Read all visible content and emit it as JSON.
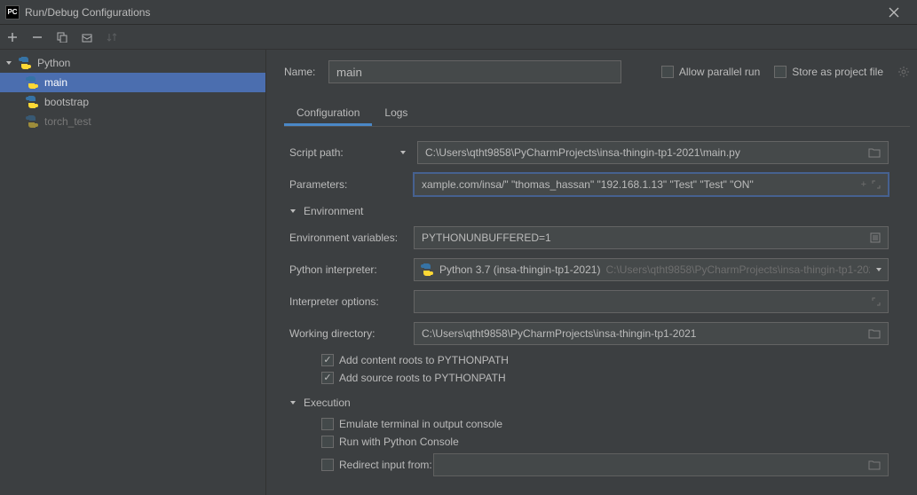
{
  "window": {
    "title": "Run/Debug Configurations"
  },
  "tree": {
    "root_label": "Python",
    "items": [
      {
        "label": "main",
        "selected": true,
        "muted": false
      },
      {
        "label": "bootstrap",
        "selected": false,
        "muted": false
      },
      {
        "label": "torch_test",
        "selected": false,
        "muted": true
      }
    ]
  },
  "header": {
    "name_label": "Name:",
    "name_value": "main",
    "allow_parallel": "Allow parallel run",
    "store_as_project": "Store as project file"
  },
  "tabs": {
    "configuration": "Configuration",
    "logs": "Logs"
  },
  "form": {
    "script_path_label": "Script path:",
    "script_path_value": "C:\\Users\\qtht9858\\PyCharmProjects\\insa-thingin-tp1-2021\\main.py",
    "parameters_label": "Parameters:",
    "parameters_value": "xample.com/insa/\"  \"thomas_hassan\"  \"192.168.1.13\"  \"Test\"  \"Test\"  \"ON\"",
    "environment_header": "Environment",
    "env_vars_label": "Environment variables:",
    "env_vars_value": "PYTHONUNBUFFERED=1",
    "interpreter_label": "Python interpreter:",
    "interpreter_name": "Python 3.7 (insa-thingin-tp1-2021)",
    "interpreter_path": "C:\\Users\\qtht9858\\PyCharmProjects\\insa-thingin-tp1-202",
    "interp_options_label": "Interpreter options:",
    "interp_options_value": "",
    "working_dir_label": "Working directory:",
    "working_dir_value": "C:\\Users\\qtht9858\\PyCharmProjects\\insa-thingin-tp1-2021",
    "add_content_roots": "Add content roots to PYTHONPATH",
    "add_source_roots": "Add source roots to PYTHONPATH",
    "execution_header": "Execution",
    "emulate_terminal": "Emulate terminal in output console",
    "run_with_console": "Run with Python Console",
    "redirect_input_label": "Redirect input from:",
    "redirect_input_value": ""
  }
}
